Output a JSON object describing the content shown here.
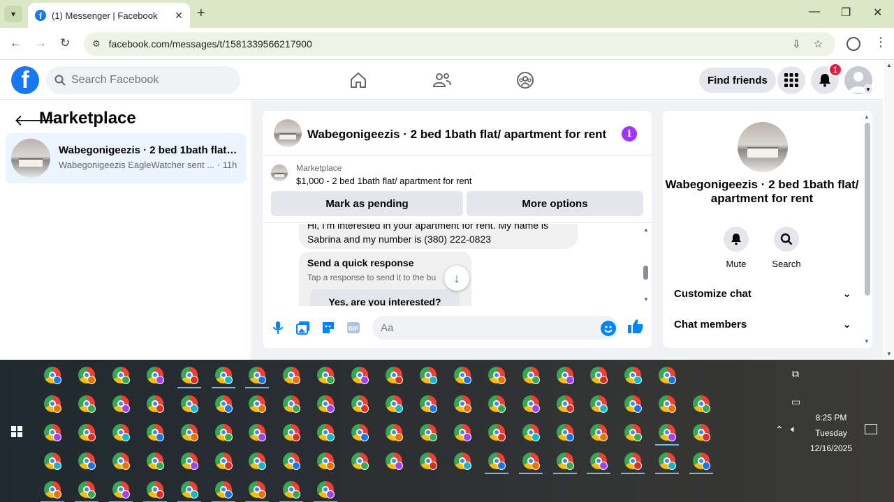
{
  "browser": {
    "tab_title": "(1) Messenger | Facebook",
    "url": "facebook.com/messages/t/1581339566217900",
    "win_minimize": "—",
    "win_restore": "❐",
    "win_close": "✕"
  },
  "facebook": {
    "logo": "f",
    "search_placeholder": "Search Facebook",
    "find_friends": "Find friends",
    "notification_count": "1"
  },
  "left_panel": {
    "title": "Marketplace",
    "conversation": {
      "name": "Wabegonigeezis · 2 bed 1bath flat/...",
      "snippet": "Wabegonigeezis EagleWatcher sent ... · 11h"
    }
  },
  "chat": {
    "title": "Wabegonigeezis · 2 bed 1bath flat/ apartment for rent",
    "banner_label": "Marketplace",
    "banner_listing": "$1,000 - 2 bed 1bath flat/ apartment for rent",
    "mark_pending": "Mark as pending",
    "more_options": "More options",
    "message": "Hi, I'm interested in your apartment for rent. My name is Sabrina and my number is (380) 222-0823",
    "quick_title": "Send a quick response",
    "quick_sub": "Tap a response to send it to the bu",
    "quick_reply": "Yes, are you interested?",
    "input_placeholder": "Aa"
  },
  "right_panel": {
    "name": "Wabegonigeezis · 2 bed 1bath flat/ apartment for rent",
    "mute": "Mute",
    "search": "Search",
    "customize_chat": "Customize chat",
    "chat_members": "Chat members"
  },
  "taskbar": {
    "time": "8:25 PM",
    "day": "Tuesday",
    "date": "12/16/2025"
  }
}
